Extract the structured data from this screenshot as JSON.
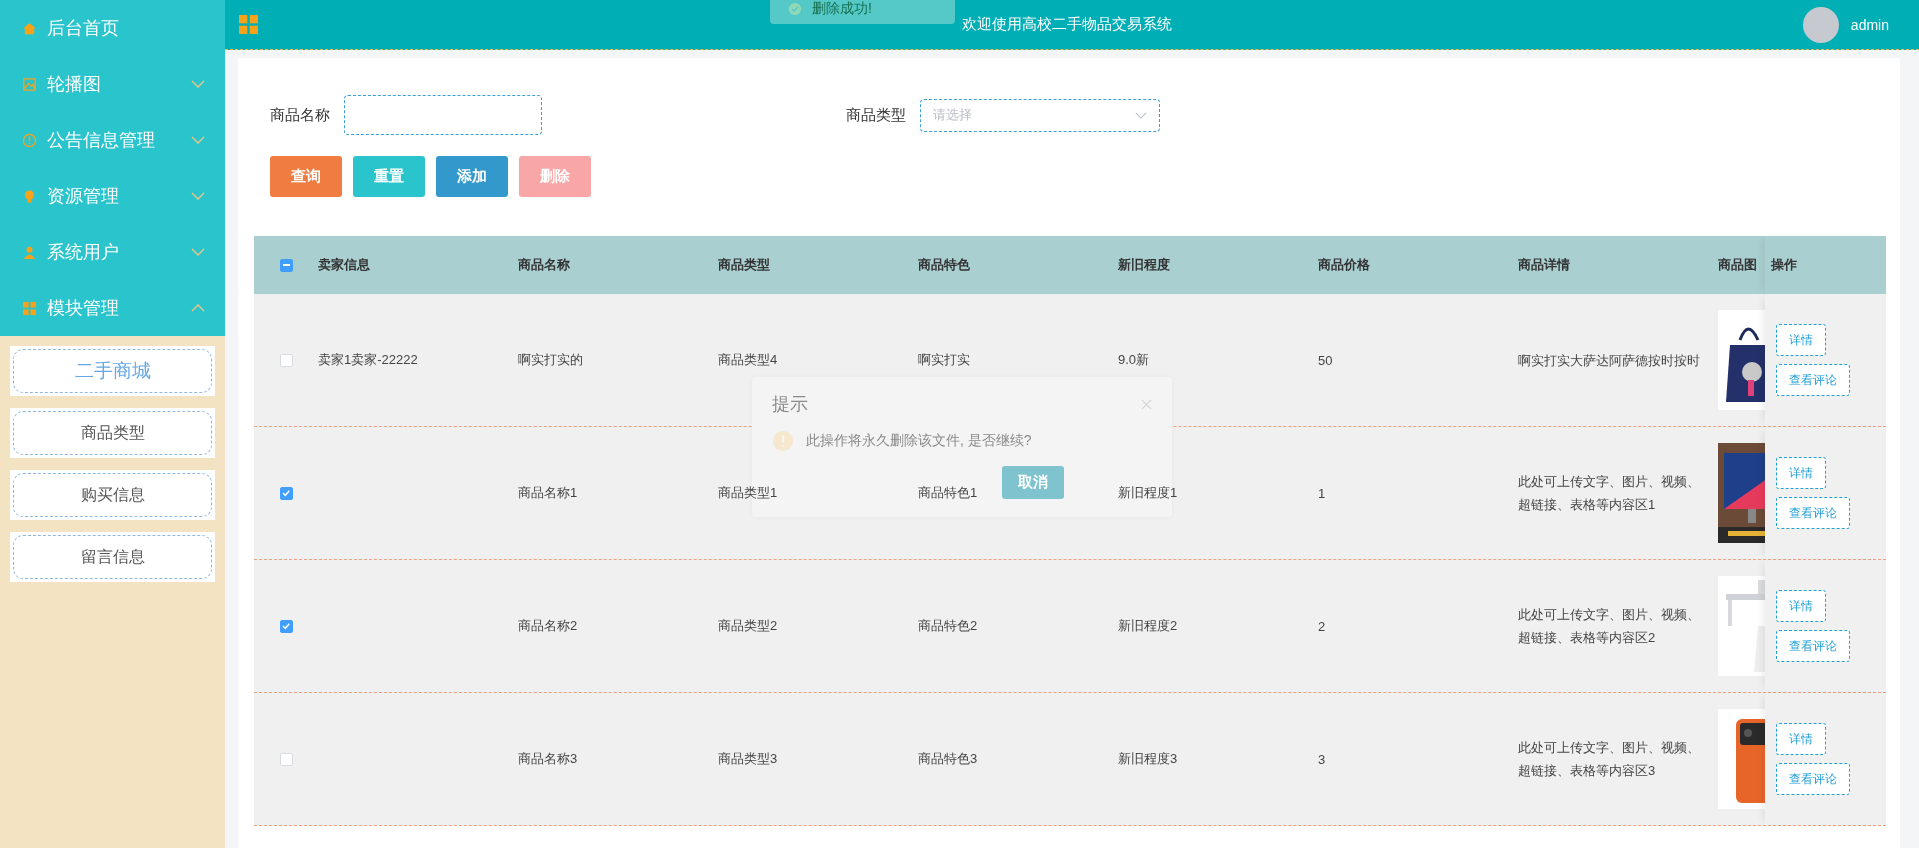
{
  "sidebar": {
    "items": [
      {
        "label": "后台首页",
        "kind": "link"
      },
      {
        "label": "轮播图",
        "kind": "menu",
        "expanded": false
      },
      {
        "label": "公告信息管理",
        "kind": "menu",
        "expanded": false
      },
      {
        "label": "资源管理",
        "kind": "menu",
        "expanded": false
      },
      {
        "label": "系统用户",
        "kind": "menu",
        "expanded": false
      },
      {
        "label": "模块管理",
        "kind": "menu",
        "expanded": true,
        "children": [
          {
            "label": "二手商城",
            "selected": true
          },
          {
            "label": "商品类型",
            "selected": false
          },
          {
            "label": "购买信息",
            "selected": false
          },
          {
            "label": "留言信息",
            "selected": false
          }
        ]
      }
    ]
  },
  "header": {
    "title": "欢迎使用高校二手物品交易系统",
    "user": {
      "name": "admin"
    }
  },
  "toast": {
    "message": "删除成功!"
  },
  "search": {
    "fields": [
      {
        "label": "商品名称",
        "kind": "input"
      },
      {
        "label": "商品类型",
        "kind": "select",
        "placeholder": "请选择"
      }
    ],
    "buttons": [
      {
        "label": "查询",
        "kind": "query",
        "disabled": false
      },
      {
        "label": "重置",
        "kind": "reset",
        "disabled": false
      },
      {
        "label": "添加",
        "kind": "add",
        "disabled": false
      },
      {
        "label": "删除",
        "kind": "delete",
        "disabled": true
      }
    ]
  },
  "table": {
    "header_checkbox": {
      "indeterminate": true
    },
    "columns": [
      "卖家信息",
      "商品名称",
      "商品类型",
      "商品特色",
      "新旧程度",
      "商品价格",
      "商品详情",
      "商品图",
      "操作"
    ],
    "rows": [
      {
        "selected": false,
        "seller": "卖家1卖家-22222",
        "name": "啊实打实的",
        "type": "商品类型4",
        "feature": "啊实打实",
        "condition": "9.0新",
        "price": "50",
        "detail": "啊实打实大萨达阿萨德按时按时",
        "actions": [
          "详情",
          "查看评论"
        ]
      },
      {
        "selected": true,
        "name": "商品名称1",
        "type": "商品类型1",
        "feature": "商品特色1",
        "condition": "新旧程度1",
        "price": "1",
        "detail": "此处可上传文字、图片、视频、超链接、表格等内容区1",
        "actions": [
          "详情",
          "查看评论"
        ]
      },
      {
        "selected": true,
        "name": "商品名称2",
        "type": "商品类型2",
        "feature": "商品特色2",
        "condition": "新旧程度2",
        "price": "2",
        "detail": "此处可上传文字、图片、视频、超链接、表格等内容区2",
        "actions": [
          "详情",
          "查看评论"
        ]
      },
      {
        "selected": false,
        "name": "商品名称3",
        "type": "商品类型3",
        "feature": "商品特色3",
        "condition": "新旧程度3",
        "price": "3",
        "detail": "此处可上传文字、图片、视频、超链接、表格等内容区3",
        "actions": [
          "详情",
          "查看评论"
        ]
      }
    ]
  },
  "dialog": {
    "title": "提示",
    "message": "此操作将永久删除该文件, 是否继续?",
    "buttons": [
      "取消"
    ]
  }
}
